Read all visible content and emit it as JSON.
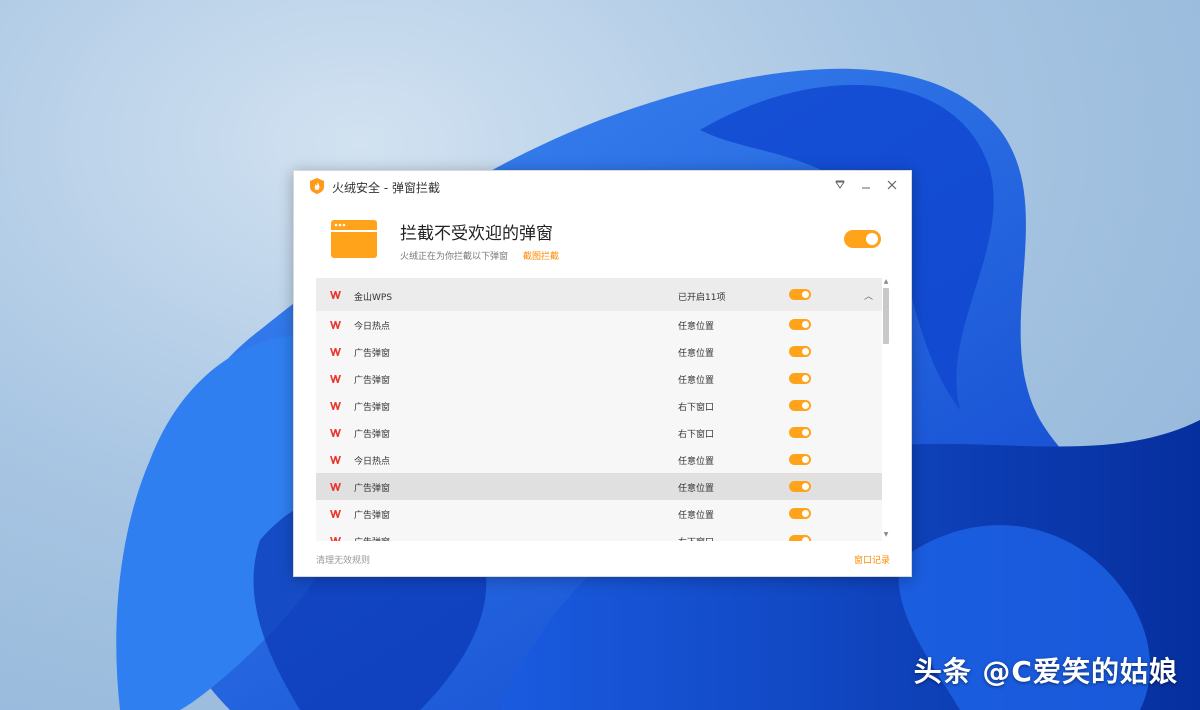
{
  "window": {
    "title": "火绒安全 - 弹窗拦截",
    "controls": {
      "skin_icon": "skin-icon",
      "minimize_icon": "minimize-icon",
      "close_icon": "close-icon"
    }
  },
  "header": {
    "headline": "拦截不受欢迎的弹窗",
    "subtitle": "火绒正在为你拦截以下弹窗",
    "link": "截图拦截",
    "toggle_on": true
  },
  "group": {
    "name": "金山WPS",
    "status": "已开启11项",
    "toggle_on": true,
    "expanded": true
  },
  "rows": [
    {
      "name": "今日热点",
      "position": "任意位置",
      "on": true
    },
    {
      "name": "广告弹窗",
      "position": "任意位置",
      "on": true
    },
    {
      "name": "广告弹窗",
      "position": "任意位置",
      "on": true
    },
    {
      "name": "广告弹窗",
      "position": "右下窗口",
      "on": true
    },
    {
      "name": "广告弹窗",
      "position": "右下窗口",
      "on": true
    },
    {
      "name": "今日热点",
      "position": "任意位置",
      "on": true
    },
    {
      "name": "广告弹窗",
      "position": "任意位置",
      "on": true,
      "selected": true
    },
    {
      "name": "广告弹窗",
      "position": "任意位置",
      "on": true
    },
    {
      "name": "广告弹窗",
      "position": "右下窗口",
      "on": true
    }
  ],
  "footer": {
    "left": "清理无效规则",
    "right": "窗口记录"
  },
  "watermark": "头条 @C爱笑的姑娘",
  "colors": {
    "accent": "#ffa31a",
    "link": "#ff8a00",
    "wps_red": "#e8392f"
  }
}
